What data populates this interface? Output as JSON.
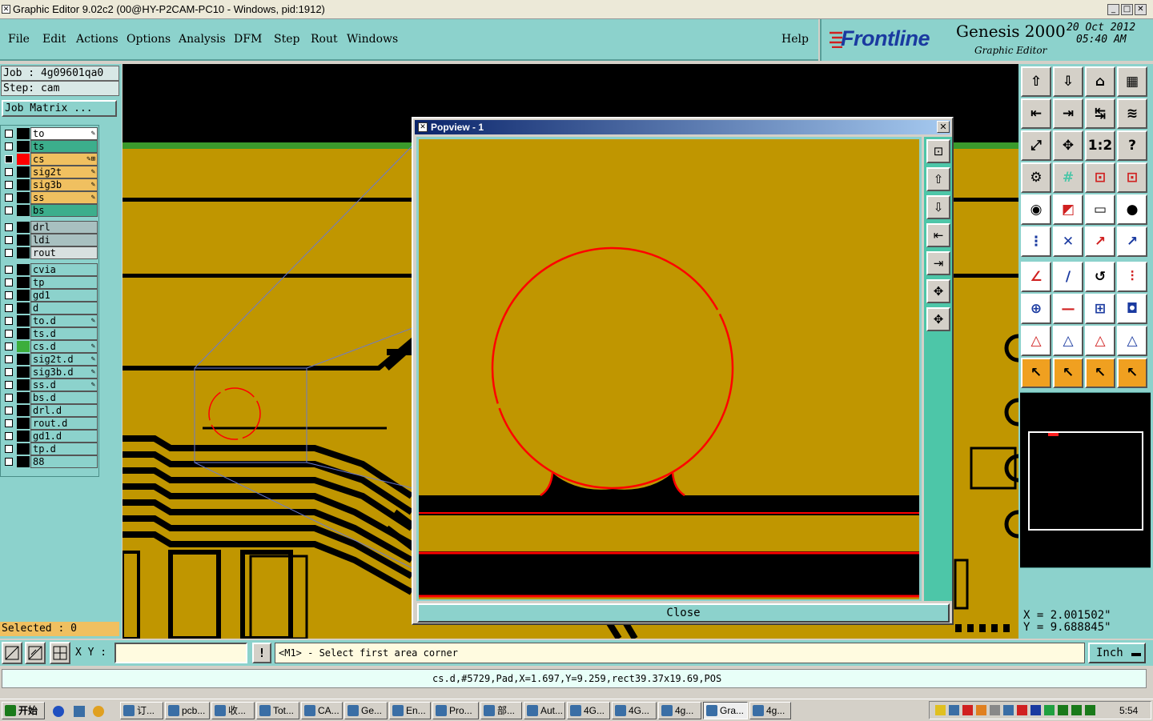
{
  "window": {
    "title": "Graphic Editor 9.02c2 (00@HY-P2CAM-PC10 - Windows, pid:1912)",
    "minimize_icon": "minimize-icon",
    "maximize_icon": "maximize-icon",
    "close_icon": "close-icon"
  },
  "menu": {
    "items": [
      "File",
      "Edit",
      "Actions",
      "Options",
      "Analysis",
      "DFM",
      "Step",
      "Rout",
      "Windows"
    ],
    "help": "Help"
  },
  "brand": {
    "logo": "Frontline",
    "product": "Genesis 2000",
    "subtitle": "Graphic Editor",
    "date": "20 Oct 2012",
    "time": "05:40 AM"
  },
  "left_panel": {
    "job": "Job : 4g09601qa0",
    "step": "Step: cam",
    "job_matrix_button": "Job Matrix ...",
    "layers": [
      {
        "name": "to",
        "color": "#ffffff",
        "icon": "✎"
      },
      {
        "name": "ts",
        "color": "#3cae8c",
        "icon": ""
      },
      {
        "name": "cs",
        "color": "#f0c060",
        "icon": "✎⊞",
        "active": true
      },
      {
        "name": "sig2t",
        "color": "#f0c060",
        "icon": "✎"
      },
      {
        "name": "sig3b",
        "color": "#f0c060",
        "icon": "✎"
      },
      {
        "name": "ss",
        "color": "#f0c060",
        "icon": "✎"
      },
      {
        "name": "bs",
        "color": "#3cae8c",
        "icon": ""
      },
      {
        "name": "drl",
        "color": "#a8c0c0",
        "icon": ""
      },
      {
        "name": "ldi",
        "color": "#a8c0c0",
        "icon": ""
      },
      {
        "name": "rout",
        "color": "#d8e0e0",
        "icon": ""
      },
      {
        "name": "cvia",
        "color": "#8cd2cc",
        "icon": ""
      },
      {
        "name": "tp",
        "color": "#8cd2cc",
        "icon": ""
      },
      {
        "name": "gd1",
        "color": "#8cd2cc",
        "icon": ""
      },
      {
        "name": "d",
        "color": "#8cd2cc",
        "icon": ""
      },
      {
        "name": "to.d",
        "color": "#8cd2cc",
        "icon": "✎"
      },
      {
        "name": "ts.d",
        "color": "#8cd2cc",
        "icon": ""
      },
      {
        "name": "cs.d",
        "color": "#8cd2cc",
        "icon": "✎",
        "swatch": "#3cae3c"
      },
      {
        "name": "sig2t.d",
        "color": "#8cd2cc",
        "icon": "✎"
      },
      {
        "name": "sig3b.d",
        "color": "#8cd2cc",
        "icon": "✎"
      },
      {
        "name": "ss.d",
        "color": "#8cd2cc",
        "icon": "✎"
      },
      {
        "name": "bs.d",
        "color": "#8cd2cc",
        "icon": ""
      },
      {
        "name": "drl.d",
        "color": "#8cd2cc",
        "icon": ""
      },
      {
        "name": "rout.d",
        "color": "#8cd2cc",
        "icon": ""
      },
      {
        "name": "gd1.d",
        "color": "#8cd2cc",
        "icon": ""
      },
      {
        "name": "tp.d",
        "color": "#8cd2cc",
        "icon": ""
      },
      {
        "name": "88",
        "color": "#8cd2cc",
        "icon": ""
      }
    ],
    "selected": "Selected : 0"
  },
  "popview": {
    "title": "Popview - 1",
    "close_button": "Close"
  },
  "right_panel": {
    "x_readout": "X = 2.001502\"",
    "y_readout": "Y = 9.688845\""
  },
  "status": {
    "xy_label": "X Y :",
    "xy_value": "",
    "prompt": "<M1> - Select first area corner",
    "units": "Inch",
    "info_line": "cs.d,#5729,Pad,X=1.697,Y=9.259,rect39.37x19.69,POS"
  },
  "taskbar": {
    "start": "开始",
    "tasks": [
      "订...",
      "pcb...",
      "收...",
      "Tot...",
      "CA...",
      "Ge...",
      "En...",
      "Pro...",
      "部...",
      "Aut...",
      "4G...",
      "4G...",
      "4g...",
      "Gra...",
      "4g..."
    ],
    "clock": "5:54"
  },
  "colors": {
    "panel": "#8cd2cc",
    "copper": "#c09600",
    "outline": "#ff0000"
  }
}
